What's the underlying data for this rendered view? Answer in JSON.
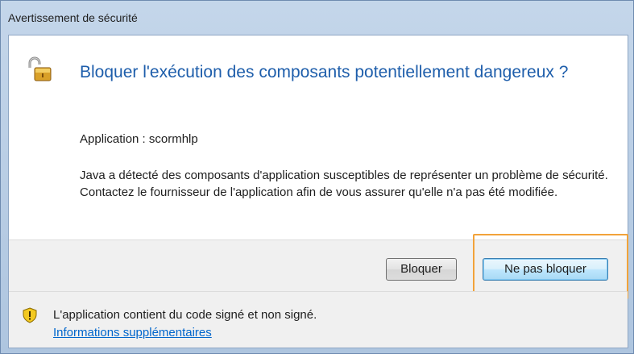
{
  "window": {
    "title": "Avertissement de sécurité"
  },
  "dialog": {
    "headline": "Bloquer l'exécution des composants potentiellement dangereux ?",
    "application_line": "Application : scormhlp",
    "message": "Java a détecté des composants d'application susceptibles de représenter un problème de sécurité. Contactez le fournisseur de l'application afin de vous assurer qu'elle n'a pas été modifiée.",
    "icon": "unlocked-padlock-icon"
  },
  "buttons": {
    "block_label": "Bloquer",
    "dont_block_label": "Ne pas bloquer"
  },
  "footer": {
    "icon": "warning-shield-icon",
    "text": "L'application contient du code signé et non signé.",
    "link": "Informations supplémentaires"
  },
  "colors": {
    "headline": "#1e5eab",
    "link": "#0066cc",
    "highlight": "#f2a33a"
  }
}
